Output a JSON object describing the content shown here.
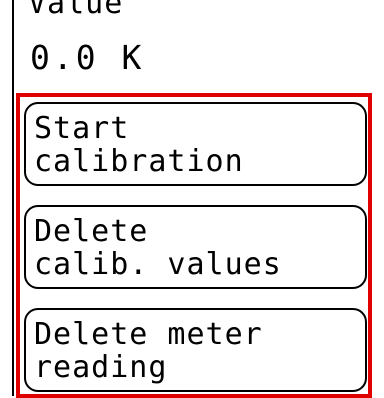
{
  "setting": {
    "label": "Value",
    "value": "0.0 K"
  },
  "menu": {
    "buttons": [
      {
        "line1": "Start",
        "line2": "calibration"
      },
      {
        "line1": "Delete",
        "line2": "calib. values"
      },
      {
        "line1": "Delete meter",
        "line2": "reading"
      }
    ]
  },
  "colors": {
    "highlight": "#e00000"
  }
}
